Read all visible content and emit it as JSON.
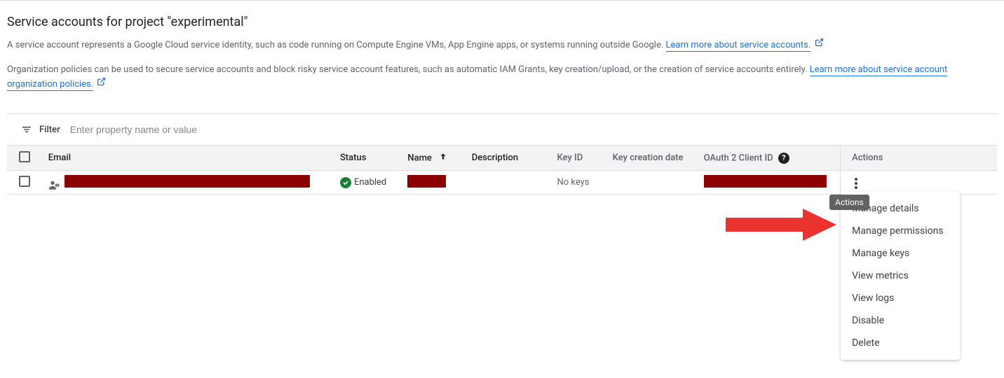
{
  "header": {
    "title": "Service accounts for project \"experimental\"",
    "desc1_prefix": "A service account represents a Google Cloud service identity, such as code running on Compute Engine VMs, App Engine apps, or systems running outside Google. ",
    "desc1_link": "Learn more about service accounts.",
    "desc2_prefix": "Organization policies can be used to secure service accounts and block risky service account features, such as automatic IAM Grants, key creation/upload, or the creation of service accounts entirely. ",
    "desc2_link": "Learn more about service account organization policies."
  },
  "filter": {
    "label": "Filter",
    "placeholder": "Enter property name or value"
  },
  "table": {
    "columns": {
      "email": "Email",
      "status": "Status",
      "name": "Name",
      "description": "Description",
      "keyid": "Key ID",
      "keydate": "Key creation date",
      "oauth": "OAuth 2 Client ID",
      "actions": "Actions"
    },
    "row": {
      "status": "Enabled",
      "keyid": "No keys"
    }
  },
  "menu": {
    "tooltip": "Actions",
    "items": [
      "Manage details",
      "Manage permissions",
      "Manage keys",
      "View metrics",
      "View logs",
      "Disable",
      "Delete"
    ]
  }
}
